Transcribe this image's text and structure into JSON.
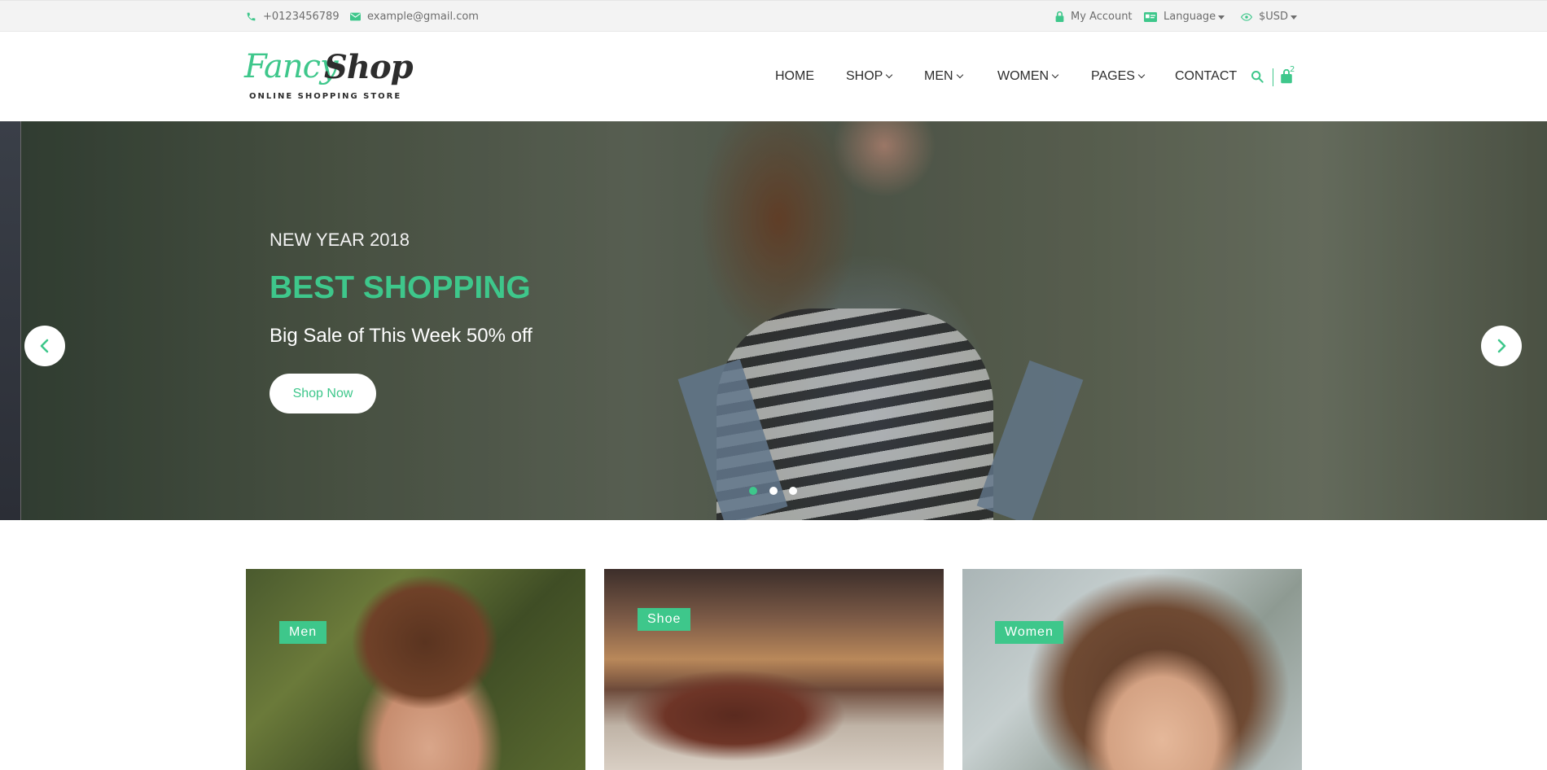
{
  "topbar": {
    "phone": "+0123456789",
    "email": "example@gmail.com",
    "account": "My Account",
    "language": "Language",
    "currency": "$USD"
  },
  "logo": {
    "word1": "Fancy",
    "word2": "Shop",
    "tagline": "ONLINE SHOPPING STORE"
  },
  "nav": {
    "items": [
      "HOME",
      "SHOP",
      "MEN",
      "WOMEN",
      "PAGES",
      "CONTACT"
    ],
    "cart_count": "2"
  },
  "hero": {
    "eyebrow": "NEW YEAR 2018",
    "headline": "BEST SHOPPING",
    "subtitle": "Big Sale of This Week 50% off",
    "button": "Shop Now",
    "slide_count": 3,
    "active_slide": 1
  },
  "categories": [
    "Men",
    "Shoe",
    "Women"
  ],
  "colors": {
    "accent": "#3ec78b",
    "topbar_bg": "#f3f3f3",
    "text_dark": "#2d2d2d"
  }
}
